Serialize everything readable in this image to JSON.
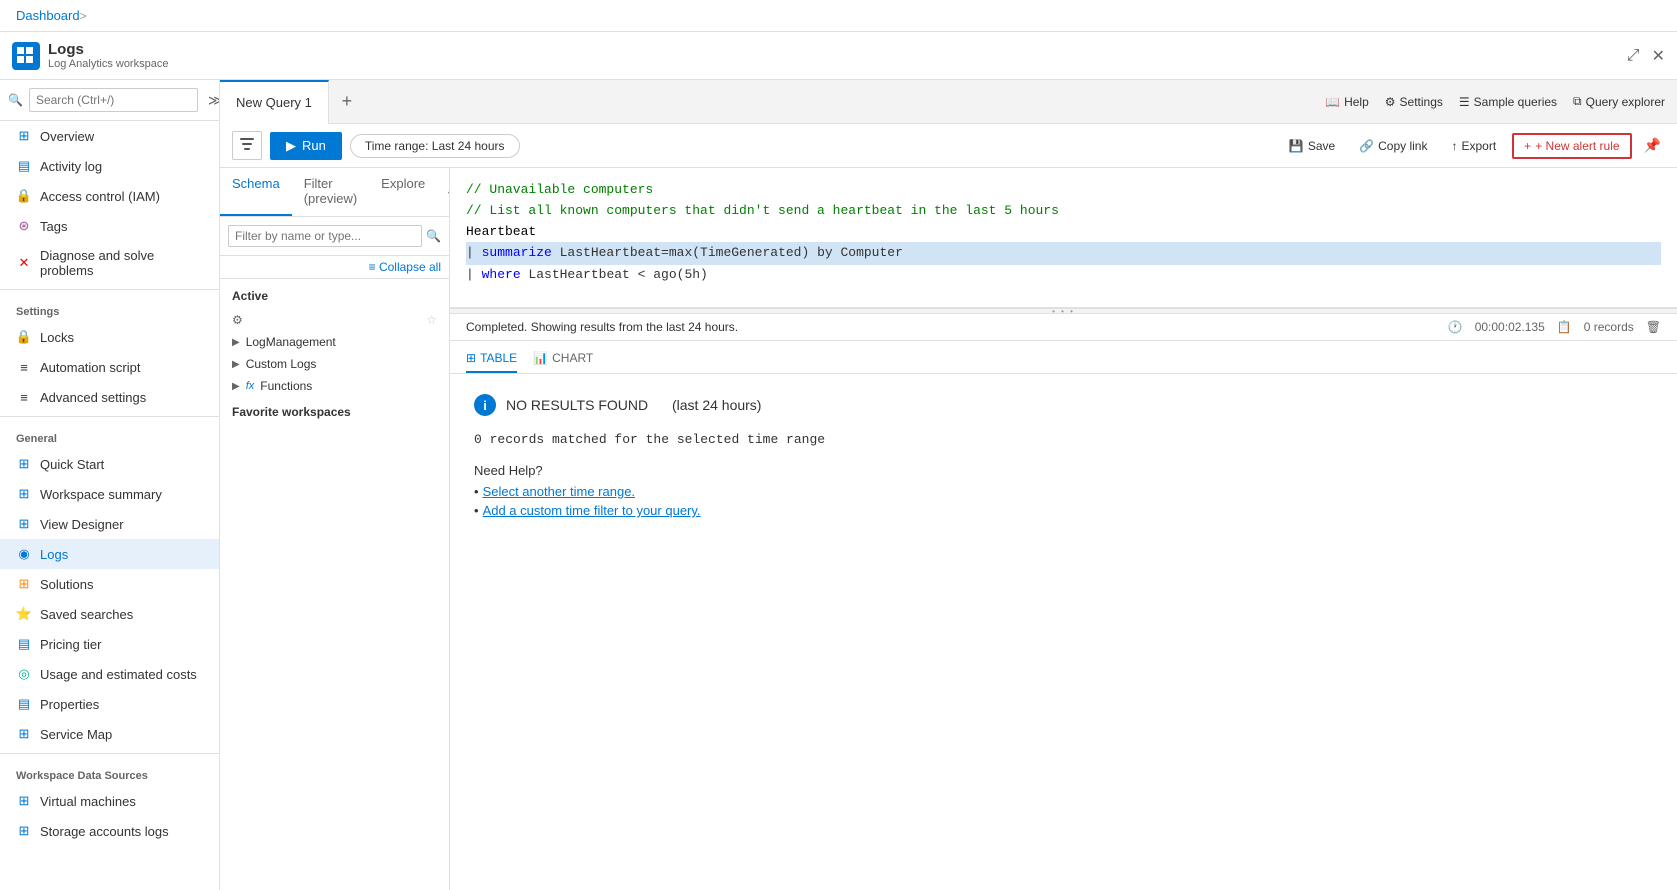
{
  "topbar": {
    "app_icon": "⊞",
    "app_title": "Logs",
    "app_subtitle": "Log Analytics workspace",
    "breadcrumb": "Dashboard",
    "breadcrumb_sep": ">",
    "minimize_icon": "⤢",
    "close_icon": "✕"
  },
  "tabs": [
    {
      "label": "New Query 1",
      "active": true
    },
    {
      "label": "+",
      "active": false
    }
  ],
  "tab_actions": [
    {
      "label": "Help",
      "icon": "❓"
    },
    {
      "label": "Settings",
      "icon": "⚙"
    },
    {
      "label": "Sample queries",
      "icon": "☰"
    },
    {
      "label": "Query explorer",
      "icon": "⧉"
    }
  ],
  "toolbar": {
    "run_label": "Run",
    "time_range_label": "Time range: Last 24 hours",
    "save_label": "Save",
    "copy_link_label": "Copy link",
    "export_label": "Export",
    "new_alert_label": "+ New alert rule",
    "pin_label": "Pin"
  },
  "schema_panel": {
    "tabs": [
      "Schema",
      "Filter (preview)",
      "Explore"
    ],
    "active_tab": "Schema",
    "search_placeholder": "Filter by name or type...",
    "collapse_all_label": "Collapse all",
    "section_active": "Active",
    "section_favorite": "Favorite workspaces",
    "tree_items": [
      {
        "label": "LogManagement",
        "has_children": true,
        "expanded": false
      },
      {
        "label": "Custom Logs",
        "has_children": true,
        "expanded": false
      },
      {
        "label": "Functions",
        "has_children": true,
        "expanded": false
      }
    ]
  },
  "editor": {
    "lines": [
      {
        "type": "comment",
        "text": "// Unavailable computers"
      },
      {
        "type": "comment",
        "text": "// List all known computers that didn't send a heartbeat in the last 5 hours"
      },
      {
        "type": "table",
        "text": "Heartbeat"
      },
      {
        "type": "highlighted",
        "text": "| summarize LastHeartbeat=max(TimeGenerated) by Computer"
      },
      {
        "type": "normal",
        "text": "| where LastHeartbeat < ago(5h)"
      }
    ]
  },
  "results": {
    "status_text": "Completed. Showing results from the last 24 hours.",
    "time_elapsed": "00:00:02.135",
    "records_count": "0 records",
    "tabs": [
      "TABLE",
      "CHART"
    ],
    "active_tab": "TABLE",
    "no_results_title": "NO RESULTS FOUND",
    "no_results_subtitle": "(last 24 hours)",
    "no_results_msg": "0 records matched for the selected time range",
    "need_help": "Need Help?",
    "help_links": [
      "Select another time range.",
      "Add a custom time filter to your query."
    ]
  },
  "sidebar": {
    "search_placeholder": "Search (Ctrl+/)",
    "items_top": [
      {
        "label": "Overview",
        "icon": "⊞",
        "color": "#0078d4"
      },
      {
        "label": "Activity log",
        "icon": "▤",
        "color": "#0078d4"
      },
      {
        "label": "Access control (IAM)",
        "icon": "🔒",
        "color": "#0078d4"
      },
      {
        "label": "Tags",
        "icon": "⊛",
        "color": "#9b4f96"
      },
      {
        "label": "Diagnose and solve problems",
        "icon": "✕",
        "color": "#e00"
      }
    ],
    "section_settings": "Settings",
    "items_settings": [
      {
        "label": "Locks",
        "icon": "🔒",
        "color": "#333"
      },
      {
        "label": "Automation script",
        "icon": "≡",
        "color": "#333"
      },
      {
        "label": "Advanced settings",
        "icon": "≡",
        "color": "#333"
      }
    ],
    "section_general": "General",
    "items_general": [
      {
        "label": "Quick Start",
        "icon": "⊞",
        "color": "#0078d4"
      },
      {
        "label": "Workspace summary",
        "icon": "⊞",
        "color": "#0078d4"
      },
      {
        "label": "View Designer",
        "icon": "⊞",
        "color": "#0078d4"
      },
      {
        "label": "Logs",
        "icon": "◉",
        "color": "#0078d4",
        "active": true
      },
      {
        "label": "Solutions",
        "icon": "⊞",
        "color": "#ff8c00"
      },
      {
        "label": "Saved searches",
        "icon": "▤",
        "color": "#0078d4"
      },
      {
        "label": "Pricing tier",
        "icon": "▤",
        "color": "#0078d4"
      },
      {
        "label": "Usage and estimated costs",
        "icon": "◎",
        "color": "#00b294"
      },
      {
        "label": "Properties",
        "icon": "▤",
        "color": "#0078d4"
      },
      {
        "label": "Service Map",
        "icon": "⊞",
        "color": "#0078d4"
      }
    ],
    "section_workspace": "Workspace Data Sources",
    "items_workspace": [
      {
        "label": "Virtual machines",
        "icon": "⊞",
        "color": "#0078d4"
      },
      {
        "label": "Storage accounts logs",
        "icon": "⊞",
        "color": "#0078d4"
      }
    ]
  }
}
